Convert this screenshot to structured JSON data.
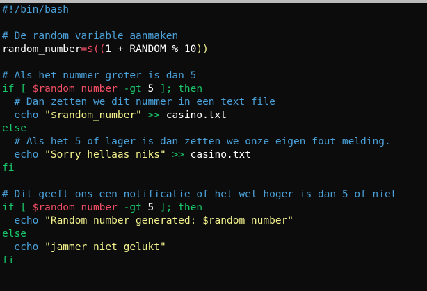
{
  "editor": {
    "lines": [
      {
        "tokens": [
          {
            "t": "#!/bin/bash",
            "k": "comment"
          }
        ]
      },
      {
        "tokens": []
      },
      {
        "tokens": [
          {
            "t": "# De random variable aanmaken",
            "k": "comment"
          }
        ]
      },
      {
        "tokens": [
          {
            "t": "random_number",
            "k": "text"
          },
          {
            "t": "=$((",
            "k": "subst"
          },
          {
            "t": "1 + RANDOM % 10",
            "k": "text"
          },
          {
            "t": "))",
            "k": "paren"
          }
        ]
      },
      {
        "tokens": []
      },
      {
        "tokens": [
          {
            "t": "# Als het nummer groter is dan 5",
            "k": "comment"
          }
        ]
      },
      {
        "tokens": [
          {
            "t": "if [ ",
            "k": "keyword"
          },
          {
            "t": "$random_number",
            "k": "var"
          },
          {
            "t": " -gt ",
            "k": "keyword"
          },
          {
            "t": "5",
            "k": "num"
          },
          {
            "t": " ]; then",
            "k": "keyword"
          }
        ]
      },
      {
        "tokens": [
          {
            "t": "  # Dan zetten we dit nummer in een text file",
            "k": "comment"
          }
        ]
      },
      {
        "tokens": [
          {
            "t": "  echo ",
            "k": "comment"
          },
          {
            "t": "\"$random_number\"",
            "k": "str"
          },
          {
            "t": " >> ",
            "k": "keyword"
          },
          {
            "t": "casino.txt",
            "k": "text"
          }
        ]
      },
      {
        "tokens": [
          {
            "t": "else",
            "k": "keyword"
          }
        ]
      },
      {
        "tokens": [
          {
            "t": "  # Als het 5 of lager is dan zetten we onze eigen fout melding.",
            "k": "comment"
          }
        ]
      },
      {
        "tokens": [
          {
            "t": "  echo ",
            "k": "comment"
          },
          {
            "t": "\"Sorry hellaas niks\"",
            "k": "str"
          },
          {
            "t": " >> ",
            "k": "keyword"
          },
          {
            "t": "casino.txt",
            "k": "text"
          }
        ]
      },
      {
        "tokens": [
          {
            "t": "fi",
            "k": "keyword"
          }
        ]
      },
      {
        "tokens": []
      },
      {
        "tokens": [
          {
            "t": "# Dit geeft ons een notificatie of het wel hoger is dan 5 of niet",
            "k": "comment"
          }
        ]
      },
      {
        "tokens": [
          {
            "t": "if [ ",
            "k": "keyword"
          },
          {
            "t": "$random_number",
            "k": "var"
          },
          {
            "t": " -gt ",
            "k": "keyword"
          },
          {
            "t": "5",
            "k": "num"
          },
          {
            "t": " ]; then",
            "k": "keyword"
          }
        ]
      },
      {
        "tokens": [
          {
            "t": "  echo ",
            "k": "comment"
          },
          {
            "t": "\"Random number generated: $random_number\"",
            "k": "str"
          }
        ]
      },
      {
        "tokens": [
          {
            "t": "else",
            "k": "keyword"
          }
        ]
      },
      {
        "tokens": [
          {
            "t": "  echo ",
            "k": "comment"
          },
          {
            "t": "\"jammer niet gelukt\"",
            "k": "str"
          }
        ]
      },
      {
        "tokens": [
          {
            "t": "fi",
            "k": "keyword"
          }
        ]
      }
    ]
  },
  "colors": {
    "background": "#0c0c0c",
    "comment": "#4aa0d8",
    "keyword": "#18c76a",
    "variable": "#ef4d63",
    "string": "#f1f08c",
    "text": "#ffffff"
  }
}
